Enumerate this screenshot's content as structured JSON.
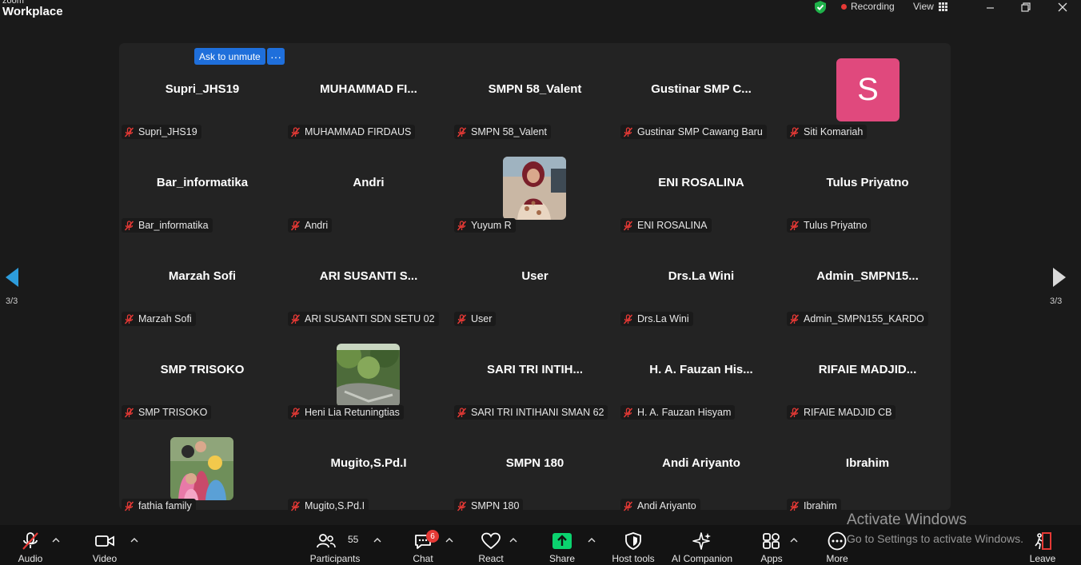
{
  "app": {
    "brand_small": "zoom",
    "brand_large": "Workplace"
  },
  "titlebar": {
    "recording": "Recording",
    "view": "View"
  },
  "tile_controls": {
    "ask_to_unmute": "Ask to unmute",
    "more": "···"
  },
  "avatar_initial": "S",
  "participants": [
    {
      "display": "Supri_JHS19",
      "label": "Supri_JHS19"
    },
    {
      "display": "MUHAMMAD  FI...",
      "label": "MUHAMMAD FIRDAUS"
    },
    {
      "display": "SMPN 58_Valent",
      "label": "SMPN 58_Valent"
    },
    {
      "display": "Gustinar  SMP  C...",
      "label": "Gustinar SMP Cawang Baru"
    },
    {
      "display": "",
      "label": "Siti Komariah"
    },
    {
      "display": "Bar_informatika",
      "label": "Bar_informatika"
    },
    {
      "display": "Andri",
      "label": "Andri"
    },
    {
      "display": "",
      "label": "Yuyum R"
    },
    {
      "display": "ENI ROSALINA",
      "label": "ENI ROSALINA"
    },
    {
      "display": "Tulus Priyatno",
      "label": "Tulus Priyatno"
    },
    {
      "display": "Marzah Sofi",
      "label": "Marzah Sofi"
    },
    {
      "display": "ARI SUSANTI S...",
      "label": "ARI SUSANTI SDN SETU 02"
    },
    {
      "display": "User",
      "label": "User"
    },
    {
      "display": "Drs.La Wini",
      "label": "Drs.La Wini"
    },
    {
      "display": "Admin_SMPN15...",
      "label": "Admin_SMPN155_KARDO"
    },
    {
      "display": "SMP TRISOKO",
      "label": "SMP TRISOKO"
    },
    {
      "display": "",
      "label": "Heni Lia Retuningtias"
    },
    {
      "display": "SARI TRI INTIH...",
      "label": "SARI TRI INTIHANI SMAN 62"
    },
    {
      "display": "H. A. Fauzan His...",
      "label": "H. A. Fauzan Hisyam"
    },
    {
      "display": "RIFAIE MADJID...",
      "label": "RIFAIE MADJID CB"
    },
    {
      "display": "",
      "label": "fathia family"
    },
    {
      "display": "Mugito,S.Pd.I",
      "label": "Mugito,S.Pd.I"
    },
    {
      "display": "SMPN 180",
      "label": "SMPN 180"
    },
    {
      "display": "Andi Ariyanto",
      "label": "Andi Ariyanto"
    },
    {
      "display": "Ibrahim",
      "label": "Ibrahim"
    }
  ],
  "pager": {
    "left": "3/3",
    "right": "3/3"
  },
  "toolbar": {
    "audio": "Audio",
    "video": "Video",
    "participants": "Participants",
    "participants_count": "55",
    "chat": "Chat",
    "chat_badge": "6",
    "react": "React",
    "share": "Share",
    "host_tools": "Host tools",
    "ai_companion": "AI Companion",
    "apps": "Apps",
    "more": "More",
    "leave": "Leave"
  },
  "watermark": {
    "line1": "Activate Windows",
    "line2": "Go to Settings to activate Windows."
  },
  "colors": {
    "share_green": "#0bd36f",
    "avatar_pink": "#e0497d",
    "unmute_blue": "#1f6fdb",
    "muted_red": "#e53935"
  }
}
